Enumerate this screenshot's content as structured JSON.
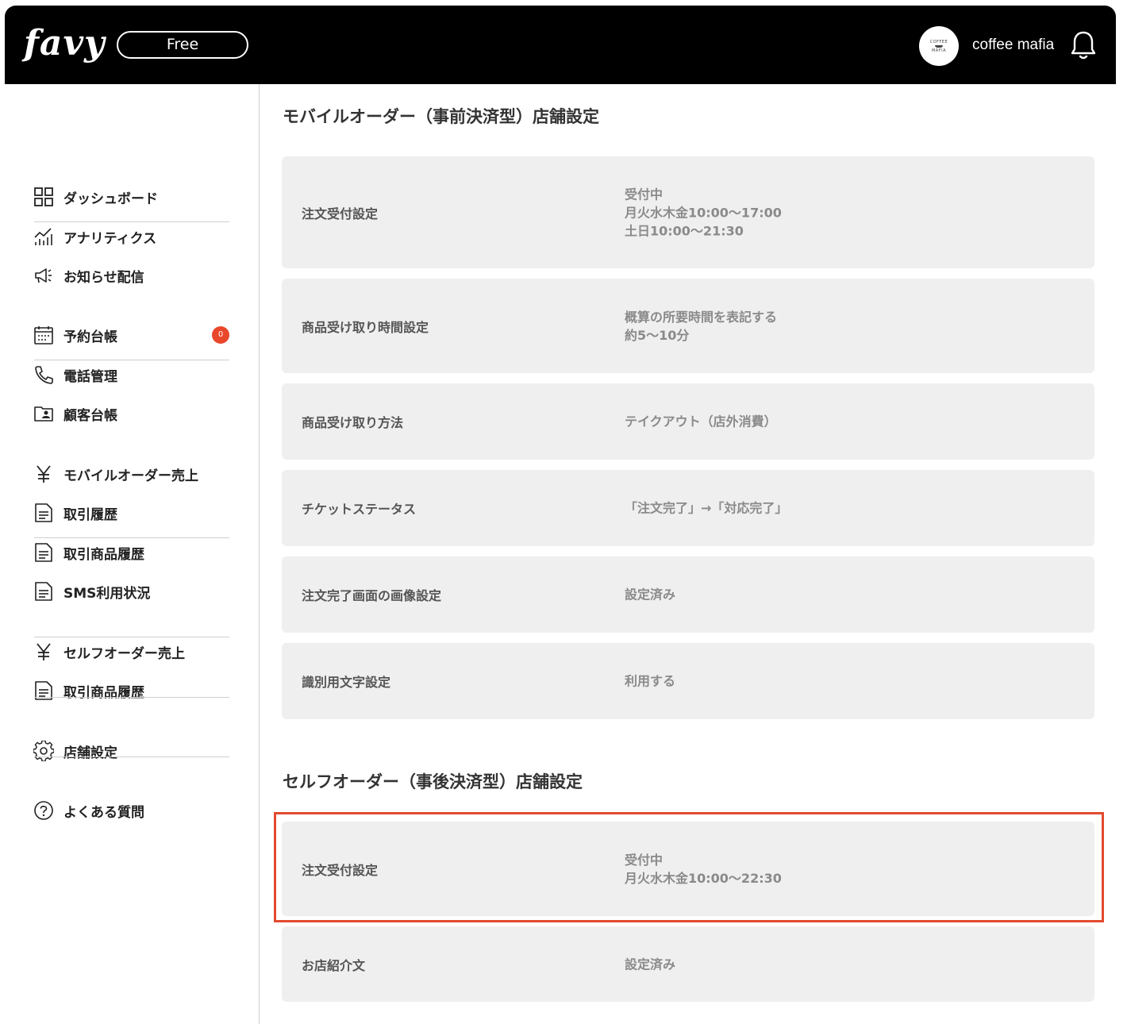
{
  "header": {
    "logo": "favy",
    "plan": "Free",
    "avatar": {
      "line1": "COFFEE",
      "line2": "MAFIA"
    },
    "store_name": "coffee mafia"
  },
  "sidebar": {
    "items": [
      {
        "label": "ダッシュボード",
        "icon": "dashboard-icon"
      },
      {
        "label": "アナリティクス",
        "icon": "analytics-icon"
      },
      {
        "label": "お知らせ配信",
        "icon": "megaphone-icon"
      },
      {
        "label": "予約台帳",
        "icon": "calendar-icon",
        "badge": "0"
      },
      {
        "label": "電話管理",
        "icon": "phone-icon"
      },
      {
        "label": "顧客台帳",
        "icon": "customer-card-icon"
      },
      {
        "label": "モバイルオーダー売上",
        "icon": "yen-icon"
      },
      {
        "label": "取引履歴",
        "icon": "document-icon"
      },
      {
        "label": "取引商品履歴",
        "icon": "document-icon"
      },
      {
        "label": "SMS利用状況",
        "icon": "document-icon"
      },
      {
        "label": "セルフオーダー売上",
        "icon": "yen-icon"
      },
      {
        "label": "取引商品履歴",
        "icon": "document-icon"
      },
      {
        "label": "店舗設定",
        "icon": "gear-icon"
      },
      {
        "label": "よくある質問",
        "icon": "help-icon"
      }
    ]
  },
  "main": {
    "mobile_order": {
      "title": "モバイルオーダー（事前決済型）店舗設定",
      "rows": [
        {
          "label": "注文受付設定",
          "values": [
            "受付中",
            "月火水木金10:00〜17:00",
            "土日10:00〜21:30"
          ]
        },
        {
          "label": "商品受け取り時間設定",
          "values": [
            "概算の所要時間を表記する",
            "約5〜10分"
          ]
        },
        {
          "label": "商品受け取り方法",
          "values": [
            "テイクアウト（店外消費）"
          ]
        },
        {
          "label": "チケットステータス",
          "values": [
            "「注文完了」→「対応完了」"
          ]
        },
        {
          "label": "注文完了画面の画像設定",
          "values": [
            "設定済み"
          ]
        },
        {
          "label": "識別用文字設定",
          "values": [
            "利用する"
          ]
        }
      ]
    },
    "self_order": {
      "title": "セルフオーダー（事後決済型）店舗設定",
      "rows": [
        {
          "label": "注文受付設定",
          "values": [
            "受付中",
            "月火水木金10:00〜22:30"
          ]
        },
        {
          "label": "お店紹介文",
          "values": [
            "設定済み"
          ]
        }
      ]
    }
  },
  "colors": {
    "header_bg": "#000000",
    "row_bg": "#efefef",
    "badge": "#e8472b",
    "highlight": "#e24a2e"
  }
}
